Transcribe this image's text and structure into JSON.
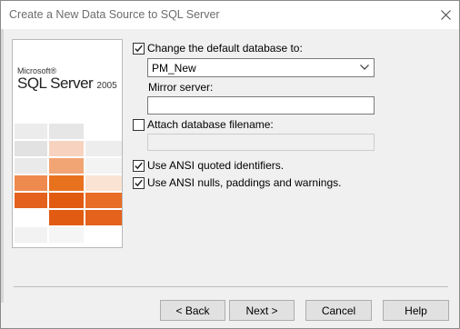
{
  "window": {
    "title": "Create a New Data Source to SQL Server"
  },
  "banner": {
    "brand_small": "Microsoft®",
    "brand_large": "SQL Server",
    "version": "2005"
  },
  "options": {
    "change_db": {
      "label": "Change the default database to:",
      "checked": true,
      "value": "PM_New"
    },
    "mirror": {
      "label": "Mirror server:",
      "value": ""
    },
    "attach": {
      "label": "Attach database filename:",
      "checked": false,
      "value": ""
    },
    "ansi_quoted": {
      "label": "Use ANSI quoted identifiers.",
      "checked": true
    },
    "ansi_nulls": {
      "label": "Use ANSI nulls, paddings and warnings.",
      "checked": true
    }
  },
  "buttons": {
    "back": "< Back",
    "next": "Next >",
    "cancel": "Cancel",
    "help": "Help"
  },
  "icons": {
    "close": "close-icon",
    "check": "checkmark-icon",
    "dropdown": "chevron-down-icon"
  }
}
